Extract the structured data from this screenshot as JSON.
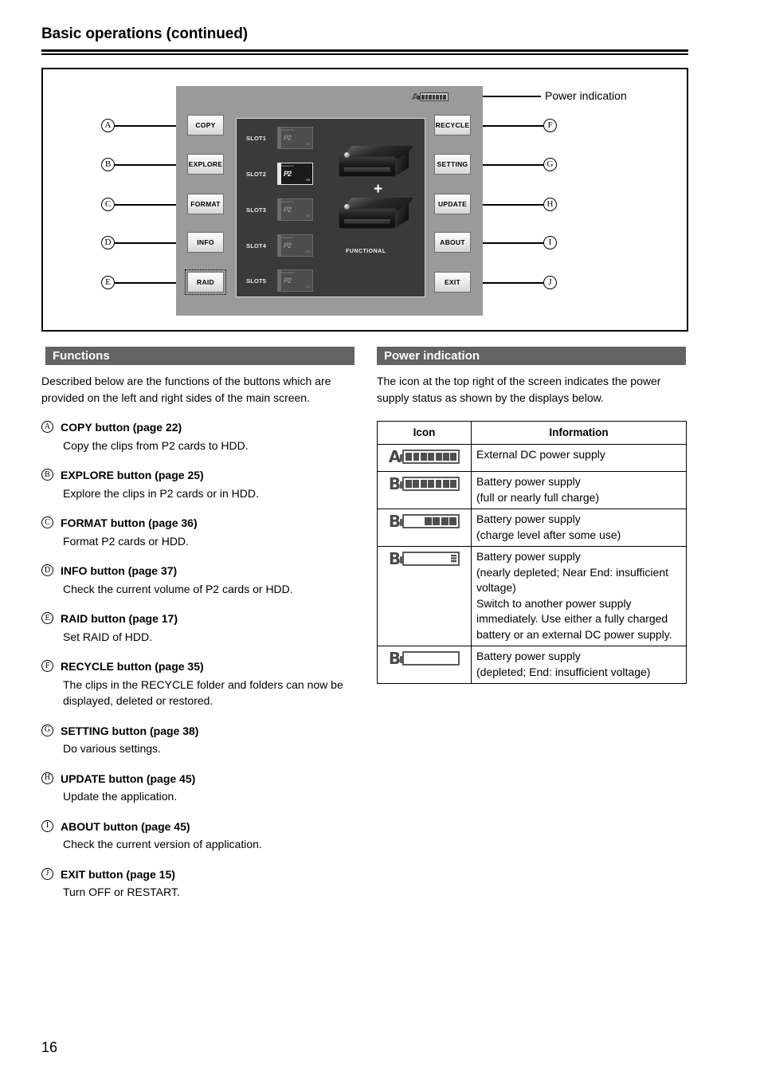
{
  "header": {
    "title": "Basic operations (continued)"
  },
  "figure": {
    "power_indication_label": "Power indication",
    "app": {
      "left_buttons": [
        {
          "label": "COPY",
          "marker": "A"
        },
        {
          "label": "EXPLORE",
          "marker": "B"
        },
        {
          "label": "FORMAT",
          "marker": "C"
        },
        {
          "label": "INFO",
          "marker": "D"
        },
        {
          "label": "RAID",
          "marker": "E"
        }
      ],
      "right_buttons": [
        {
          "label": "RECYCLE",
          "marker": "F"
        },
        {
          "label": "SETTING",
          "marker": "G"
        },
        {
          "label": "UPDATE",
          "marker": "H"
        },
        {
          "label": "ABOUT",
          "marker": "I"
        },
        {
          "label": "EXIT",
          "marker": "J"
        }
      ],
      "slots": [
        {
          "label": "SLOT1",
          "active": false
        },
        {
          "label": "SLOT2",
          "active": true
        },
        {
          "label": "SLOT3",
          "active": false
        },
        {
          "label": "SLOT4",
          "active": false
        },
        {
          "label": "SLOT5",
          "active": false
        }
      ],
      "card_logo": "P2",
      "card_brand": "Panasonic",
      "card_capacity": "GB",
      "functional_label": "FUNCTIONAL",
      "plus_sign": "+",
      "power_icon_letter": "A"
    }
  },
  "functions": {
    "heading": "Functions",
    "intro": "Described below are the functions of the buttons which are provided on the left and right sides of the main screen.",
    "items": [
      {
        "marker": "A",
        "heading": "COPY button (page 22)",
        "desc": "Copy the clips from P2 cards to HDD."
      },
      {
        "marker": "B",
        "heading": "EXPLORE button (page 25)",
        "desc": "Explore the clips in P2 cards or in HDD."
      },
      {
        "marker": "C",
        "heading": "FORMAT button (page 36)",
        "desc": "Format P2 cards or HDD."
      },
      {
        "marker": "D",
        "heading": "INFO button (page 37)",
        "desc": "Check the current volume of P2 cards or HDD."
      },
      {
        "marker": "E",
        "heading": "RAID button (page 17)",
        "desc": "Set RAID of HDD."
      },
      {
        "marker": "F",
        "heading": "RECYCLE button (page 35)",
        "desc": "The clips in the RECYCLE folder and folders can now be displayed, deleted or restored."
      },
      {
        "marker": "G",
        "heading": "SETTING button (page 38)",
        "desc": "Do various settings."
      },
      {
        "marker": "H",
        "heading": "UPDATE button (page 45)",
        "desc": "Update the application."
      },
      {
        "marker": "I",
        "heading": "ABOUT button (page 45)",
        "desc": "Check the current version of application."
      },
      {
        "marker": "J",
        "heading": "EXIT button (page 15)",
        "desc": "Turn OFF or RESTART."
      }
    ]
  },
  "power_indication": {
    "heading": "Power indication",
    "intro": "The icon at the top right of the screen indicates the power supply status as shown by the displays below.",
    "table": {
      "columns": [
        "Icon",
        "Information"
      ],
      "rows": [
        {
          "letter": "A",
          "level": "full",
          "info": "External DC power supply"
        },
        {
          "letter": "B",
          "level": "full",
          "info": "Battery power supply\n(full or nearly full charge)"
        },
        {
          "letter": "B",
          "level": "partial",
          "info": "Battery power supply\n(charge level after some use)"
        },
        {
          "letter": "B",
          "level": "low",
          "info": "Battery power supply\n(nearly depleted; Near End: insufficient voltage)\nSwitch to another power supply immediately. Use either a fully charged battery or an external DC power supply."
        },
        {
          "letter": "B",
          "level": "empty",
          "info": "Battery power supply\n(depleted; End: insufficient voltage)"
        }
      ]
    }
  },
  "footer": {
    "page_number": "16"
  }
}
